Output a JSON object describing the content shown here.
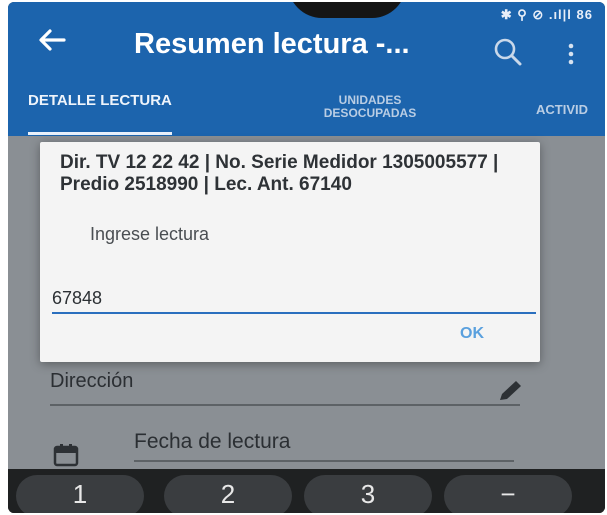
{
  "status_bar": {
    "icons_text": "✱ ⚲ ⊘ .ıl|l 86"
  },
  "app_bar": {
    "title": "Resumen lectura -...",
    "back_icon": "arrow-left-icon",
    "search_icon": "search-icon",
    "menu_icon": "more-vert-icon",
    "color": "#1c64ad"
  },
  "tabs": [
    {
      "label": "DETALLE LECTURA",
      "active": true
    },
    {
      "label": "UNIDADES DESOCUPADAS",
      "active": false
    },
    {
      "label": "ACTIVID",
      "active": false
    }
  ],
  "form": {
    "direccion_label": "Dirección",
    "fecha_label": "Fecha de lectura",
    "edit_icon": "pencil-icon",
    "calendar_icon": "calendar-icon"
  },
  "dialog": {
    "message": "Dir. TV 12 22 42 | No. Serie Medidor 1305005577 | Predio 2518990 | Lec. Ant. 67140",
    "hint": "Ingrese lectura",
    "value": "67848",
    "ok_label": "OK",
    "accent": "#2a6fbe"
  },
  "keypad": {
    "keys": [
      "1",
      "2",
      "3",
      "−"
    ]
  }
}
